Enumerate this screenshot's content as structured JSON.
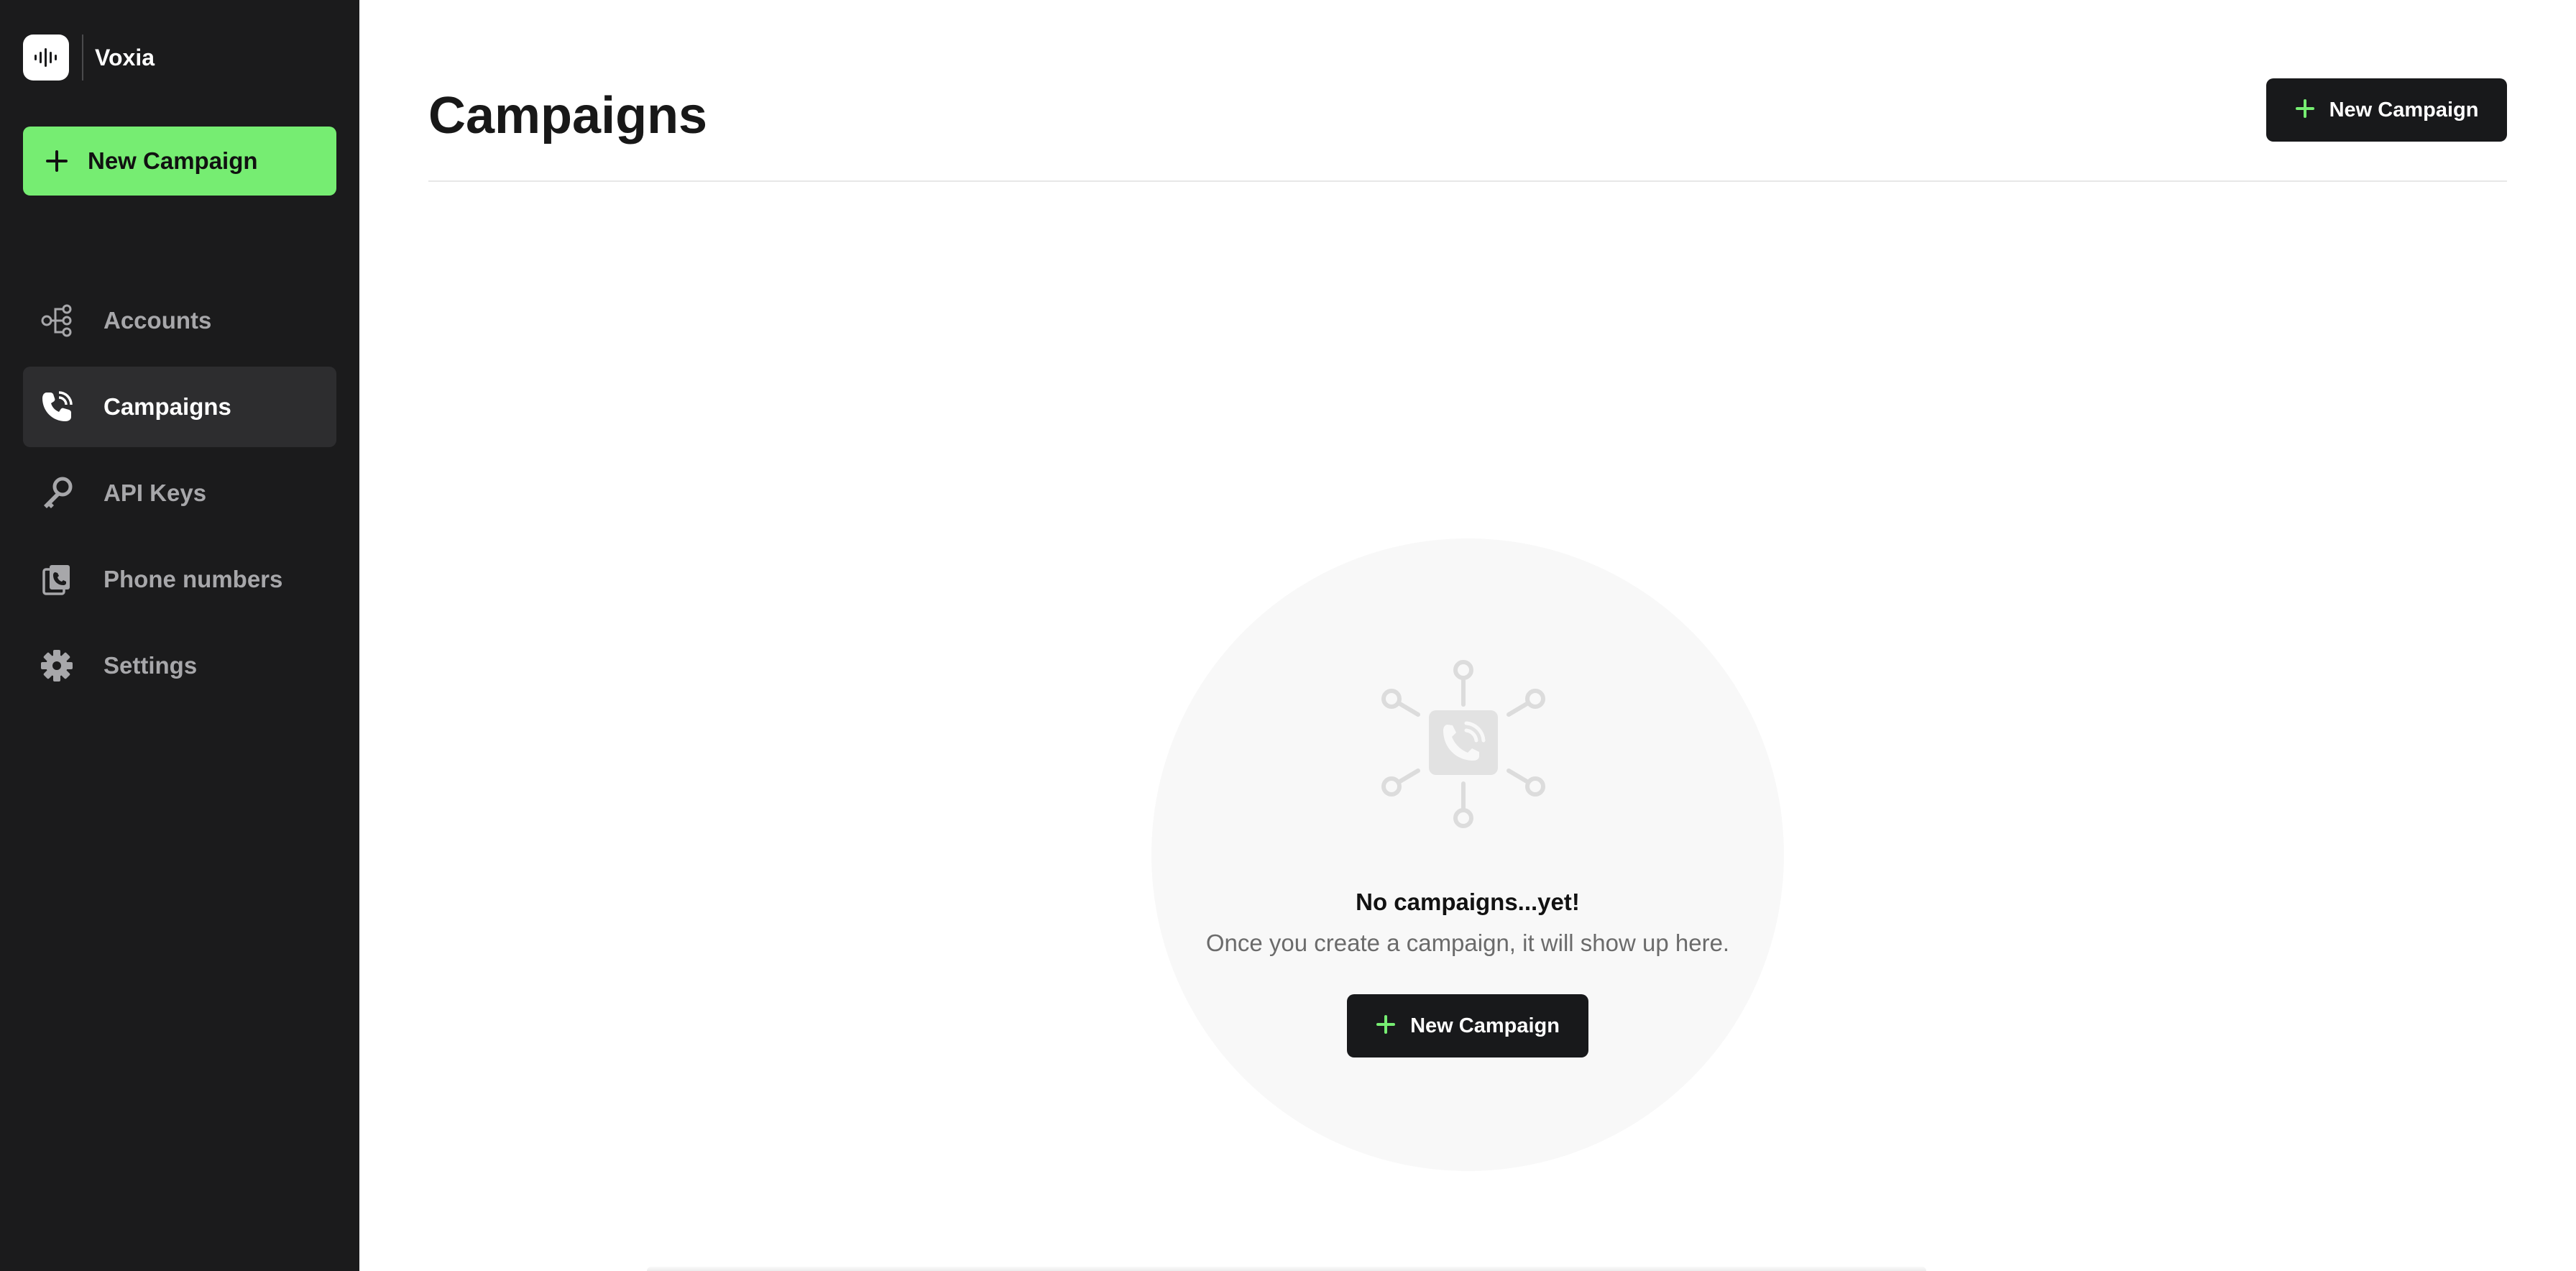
{
  "brand": {
    "name": "Voxia",
    "logo_icon": "waveform-icon"
  },
  "sidebar": {
    "new_button_label": "New Campaign",
    "new_button_color": "#76ed72",
    "items": [
      {
        "label": "Accounts",
        "icon": "accounts-tree-icon",
        "active": false
      },
      {
        "label": "Campaigns",
        "icon": "phone-call-icon",
        "active": true
      },
      {
        "label": "API Keys",
        "icon": "key-icon",
        "active": false
      },
      {
        "label": "Phone numbers",
        "icon": "phone-numbers-icon",
        "active": false
      },
      {
        "label": "Settings",
        "icon": "gear-icon",
        "active": false
      }
    ]
  },
  "main": {
    "title": "Campaigns",
    "header_button_label": "New Campaign",
    "empty_state": {
      "illustration": "phone-network-icon",
      "title": "No campaigns...yet!",
      "subtitle": "Once you create a campaign, it will show up here.",
      "button_label": "New Campaign"
    }
  },
  "colors": {
    "sidebar_bg": "#1b1b1c",
    "accent_green": "#76ed72",
    "dark_button": "#18191b"
  }
}
